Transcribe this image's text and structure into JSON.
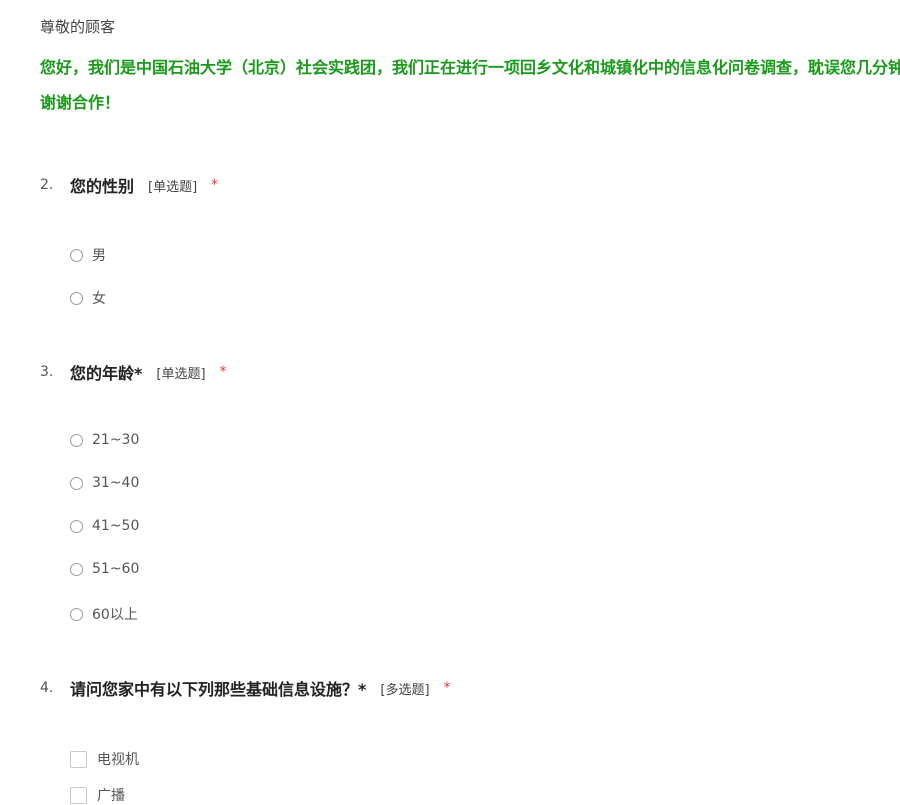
{
  "greeting": "尊敬的顾客",
  "intro": {
    "line1": "您好，我们是中国石油大学（北京）社会实践团，我们正在进行一项回乡文化和城镇化中的信息化问卷调查，耽误您几分钟",
    "line2": "谢谢合作！"
  },
  "questions": [
    {
      "number": "2.",
      "title": "您的性别",
      "type": "[单选题]",
      "required": "*",
      "options": [
        "男",
        "女"
      ]
    },
    {
      "number": "3.",
      "title": "您的年龄*",
      "type": "[单选题]",
      "required": "*",
      "options": [
        "21~30",
        "31~40",
        "41~50",
        "51~60",
        "60以上"
      ]
    },
    {
      "number": "4.",
      "title": "请问您家中有以下列那些基础信息设施？*",
      "type": "[多选题]",
      "required": "*",
      "options": [
        "电视机",
        "广播"
      ]
    }
  ],
  "colors": {
    "intro_green": "#1a9a1a",
    "required_red": "#e33b3b"
  }
}
